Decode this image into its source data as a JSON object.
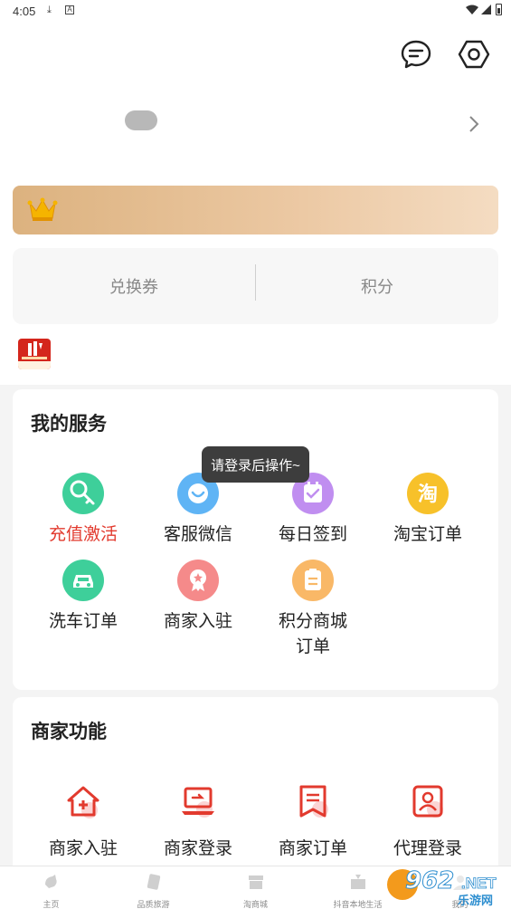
{
  "status_bar": {
    "time": "4:05"
  },
  "wallet": {
    "coupons_label": "兑换券",
    "points_label": "积分"
  },
  "toast": {
    "text": "请登录后操作~"
  },
  "my_services": {
    "title": "我的服务",
    "items": [
      {
        "label": "充值激活",
        "icon": "key-icon",
        "color": "#3ecf9a"
      },
      {
        "label": "客服微信",
        "icon": "smile-chat-icon",
        "color": "#5fb4f5"
      },
      {
        "label": "每日签到",
        "icon": "calendar-check-icon",
        "color": "#c08ef0"
      },
      {
        "label": "淘宝订单",
        "icon": "taobao-icon",
        "color": "#f7c12a"
      },
      {
        "label": "洗车订单",
        "icon": "car-icon",
        "color": "#3ecf9a"
      },
      {
        "label": "商家入驻",
        "icon": "award-icon",
        "color": "#f58a8a"
      },
      {
        "label": "积分商城订单",
        "line1": "积分商城",
        "line2": "订单",
        "icon": "note-icon",
        "color": "#f9b867"
      }
    ]
  },
  "merchant_functions": {
    "title": "商家功能",
    "items": [
      {
        "label": "商家入驻",
        "icon": "house-plus-icon"
      },
      {
        "label": "商家登录",
        "icon": "laptop-login-icon"
      },
      {
        "label": "商家订单",
        "icon": "receipt-icon"
      },
      {
        "label": "代理登录",
        "icon": "agent-portrait-icon"
      }
    ]
  },
  "tabbar": {
    "items": [
      {
        "label": "主页",
        "icon": "home-icon"
      },
      {
        "label": "品质旅游",
        "icon": "travel-icon"
      },
      {
        "label": "淘商城",
        "icon": "shop-icon"
      },
      {
        "label": "抖音本地生活",
        "icon": "local-life-icon"
      },
      {
        "label": "我的",
        "icon": "profile-icon"
      }
    ]
  },
  "watermark": {
    "number": "962",
    "suffix": ".NET",
    "chinese": "乐游网"
  },
  "colors": {
    "accent_red": "#e23a2e",
    "vip_gold": "#dcb27f"
  }
}
